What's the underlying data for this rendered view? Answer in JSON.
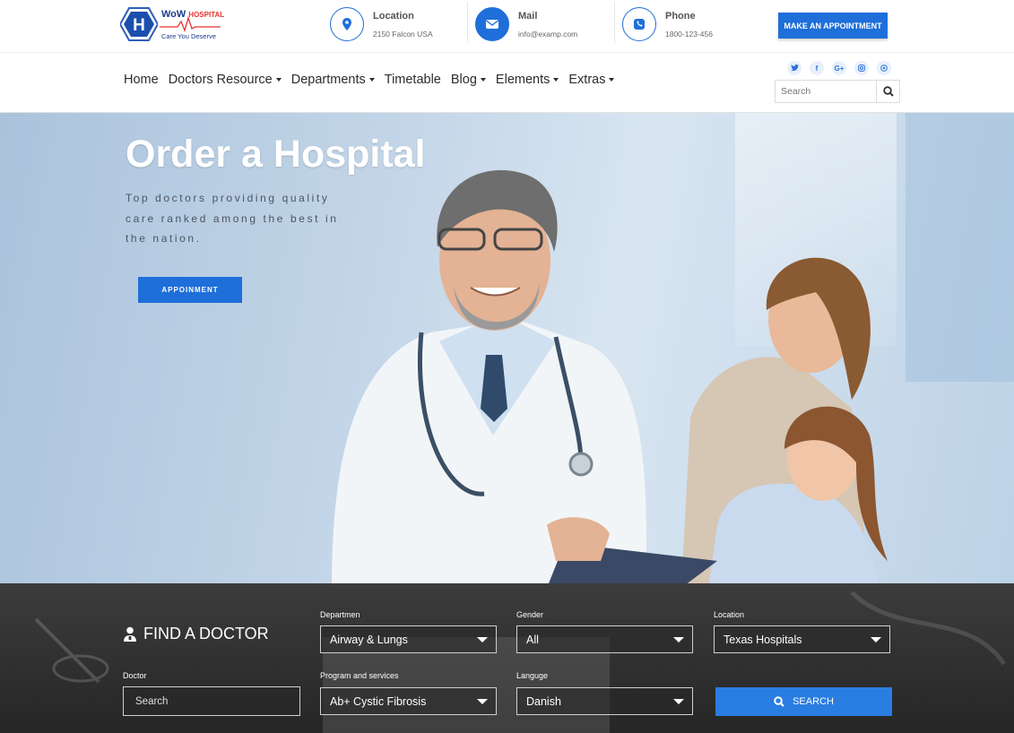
{
  "logo": {
    "brand": "WoW",
    "brand_accent": "HOSPITAL",
    "tagline": "Care You Deserve"
  },
  "header": {
    "location": {
      "label": "Location",
      "value": "2150 Falcon USA"
    },
    "mail": {
      "label": "Mail",
      "value": "info@examp.com"
    },
    "phone": {
      "label": "Phone",
      "value": "1800-123-456"
    },
    "appointment_button": "MAKE AN APPOINTMENT"
  },
  "nav": {
    "items": [
      {
        "label": "Home",
        "dropdown": false
      },
      {
        "label": "Doctors Resource",
        "dropdown": true
      },
      {
        "label": "Departments",
        "dropdown": true
      },
      {
        "label": "Timetable",
        "dropdown": false
      },
      {
        "label": "Blog",
        "dropdown": true
      },
      {
        "label": "Elements",
        "dropdown": true
      },
      {
        "label": "Extras",
        "dropdown": true
      }
    ],
    "socials": [
      "twitter-icon",
      "facebook-icon",
      "google-plus-icon",
      "instagram-icon",
      "pinterest-icon"
    ],
    "search_placeholder": "Search"
  },
  "hero": {
    "title": "Order a Hospital",
    "subtitle": "Top doctors providing quality care ranked among the best in the nation.",
    "button": "APPOINMENT"
  },
  "finder": {
    "title": "FIND A DOCTOR",
    "doctor_label": "Doctor",
    "doctor_placeholder": "Search",
    "department": {
      "label": "Departmen",
      "value": "Airway & Lungs"
    },
    "gender": {
      "label": "Gender",
      "value": "All"
    },
    "location": {
      "label": "Location",
      "value": "Texas Hospitals"
    },
    "program": {
      "label": "Program and services",
      "value": "Ab+ Cystic Fibrosis"
    },
    "language": {
      "label": "Languge",
      "value": "Danish"
    },
    "search_button": "SEARCH"
  },
  "colors": {
    "accent": "#1e6fd9",
    "brand": "#1b3a8f",
    "brand_red": "#e4342f",
    "finder_bg": "#2e2e2e"
  }
}
